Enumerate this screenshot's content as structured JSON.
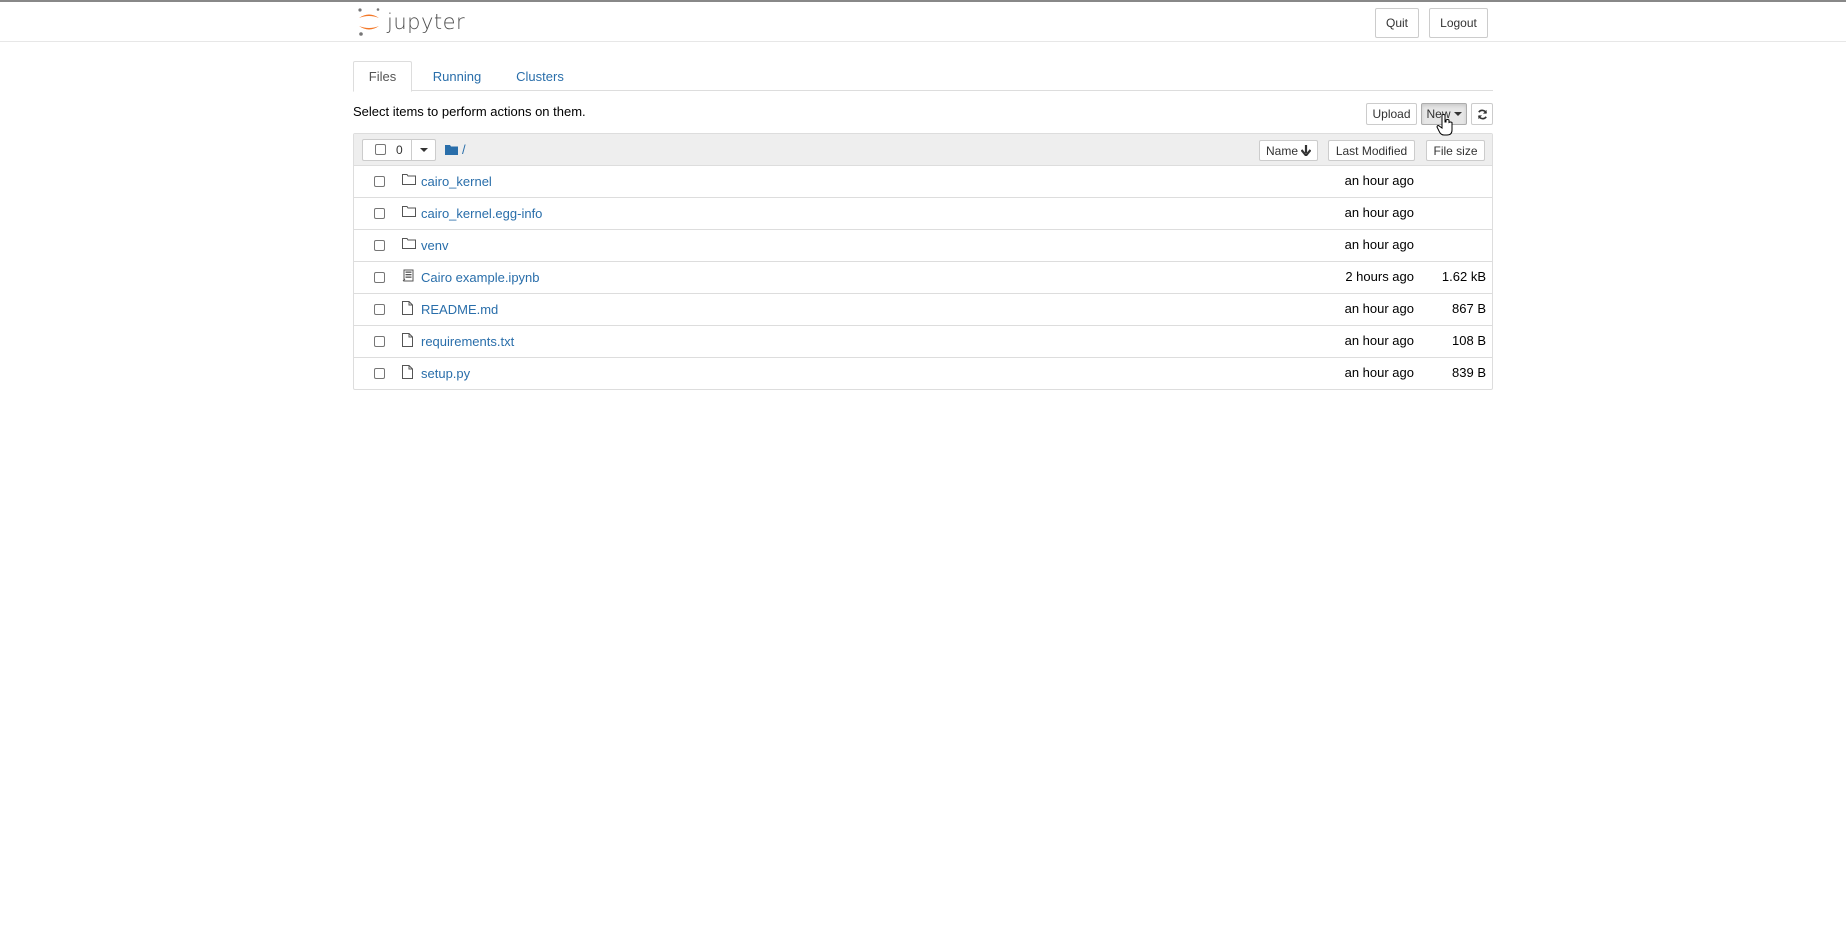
{
  "header": {
    "logo_text": "jupyter",
    "quit_label": "Quit",
    "logout_label": "Logout"
  },
  "tabs": [
    {
      "label": "Files",
      "active": true
    },
    {
      "label": "Running",
      "active": false
    },
    {
      "label": "Clusters",
      "active": false
    }
  ],
  "toolbar": {
    "hint": "Select items to perform actions on them.",
    "upload_label": "Upload",
    "new_label": "New"
  },
  "list_header": {
    "selected_count": "0",
    "breadcrumb": "/",
    "sort_name": "Name",
    "sort_modified": "Last Modified",
    "sort_size": "File size"
  },
  "files": [
    {
      "name": "cairo_kernel",
      "type": "folder",
      "modified": "an hour ago",
      "size": ""
    },
    {
      "name": "cairo_kernel.egg-info",
      "type": "folder",
      "modified": "an hour ago",
      "size": ""
    },
    {
      "name": "venv",
      "type": "folder",
      "modified": "an hour ago",
      "size": ""
    },
    {
      "name": "Cairo example.ipynb",
      "type": "notebook",
      "modified": "2 hours ago",
      "size": "1.62 kB"
    },
    {
      "name": "README.md",
      "type": "file",
      "modified": "an hour ago",
      "size": "867 B"
    },
    {
      "name": "requirements.txt",
      "type": "file",
      "modified": "an hour ago",
      "size": "108 B"
    },
    {
      "name": "setup.py",
      "type": "file",
      "modified": "an hour ago",
      "size": "839 B"
    }
  ],
  "colors": {
    "link": "#296eaa",
    "logo_orange": "#f37726",
    "border": "#dddddd",
    "header_bg": "#eeeeee"
  }
}
